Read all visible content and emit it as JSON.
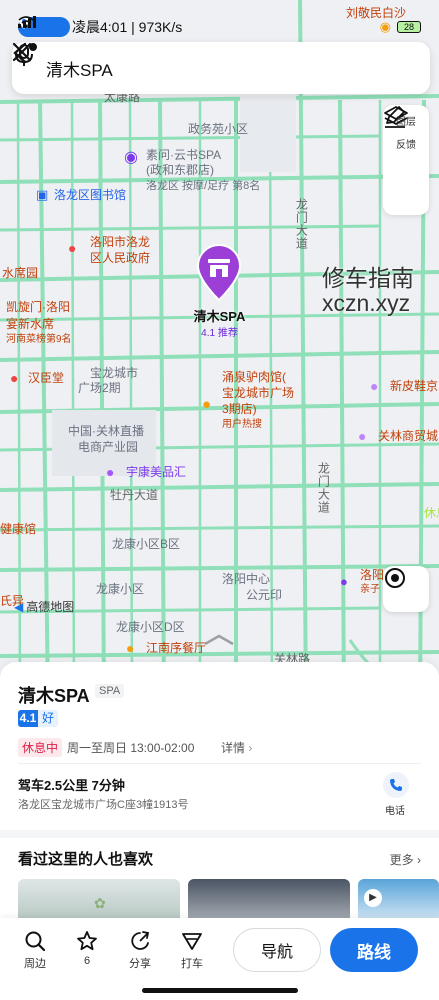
{
  "status_bar": {
    "time_speed": "凌晨4:01 | 973K/s",
    "battery": "28"
  },
  "search": {
    "query": "清木SPA"
  },
  "map_tools": {
    "layers_label": "图层",
    "feedback_label": "反馈"
  },
  "map_labels": {
    "kang": "太康路",
    "zhengwu": "政务苑小区",
    "suge": "素问·云书SPA",
    "suge2": "(政和东郡店)",
    "suge3": "洛龙区 按摩/足疗 第8名",
    "library": "洛龙区图书馆",
    "hospital1": "洛阳市洛龙",
    "hospital2": "区人民政府",
    "shuiyu": "水席园",
    "kaixuan1": "凯旋门·洛阳",
    "kaixuan2": "宴新水席",
    "kaixuan3": "河南菜榜第9名",
    "hanchen": "汉臣堂",
    "baolong1": "宝龙城市",
    "baolong2": "广场2期",
    "guanlin1": "中国·关林直播",
    "guanlin2": "电商产业园",
    "yongquan1": "涌泉驴肉馆(",
    "yongquan2": "宝龙城市广场",
    "yongquan3": "3期店)",
    "yongquan4": "用户热搜",
    "xinpi": "新皮鞋京",
    "guanlinmall": "关林商贸城",
    "yukang": "宇康美品汇",
    "mudan": "牡丹大道",
    "longmen_top": "龙门大道",
    "longmen_bottom": "龙门大道",
    "longyun": "龙康小区B区",
    "longyun2": "龙康小区",
    "longyun3": "龙康小区D区",
    "luoyang_center": "洛阳中心",
    "gongyuan": "公元印",
    "luoyang_right": "洛阳",
    "qinzi": "亲子",
    "jiangnan": "江南序餐厅",
    "guanlin_road": "关林路",
    "jiankang": "健康馆",
    "shijie": "氏异",
    "liuzhi": "刘敬民白沙",
    "xiuxi": "休息"
  },
  "pin": {
    "name": "清木SPA",
    "rating_text": "4.1 推荐"
  },
  "watermark": {
    "line1": "修车指南",
    "line2": "xczn.xyz"
  },
  "amap_logo": "高德地图",
  "poi": {
    "title": "清木SPA",
    "category": "SPA",
    "rating": "4.1",
    "rating_word": "好",
    "status": "休息中",
    "hours": "周一至周日 13:00-02:00",
    "detail": "详情",
    "drive": "驾车2.5公里 7分钟",
    "address": "洛龙区宝龙城市广场C座3幢1913号",
    "call_label": "电话"
  },
  "recommend": {
    "title": "看过这里的人也喜欢",
    "more": "更多"
  },
  "bottom_bar": {
    "nearby": "周边",
    "favorite_count": "6",
    "share": "分享",
    "taxi": "打车",
    "navigate": "导航",
    "route": "路线"
  },
  "colors": {
    "accent": "#1a73e8",
    "road": "#8fe0b8",
    "pin": "#9b3fd6",
    "closed": "#e11d48"
  }
}
